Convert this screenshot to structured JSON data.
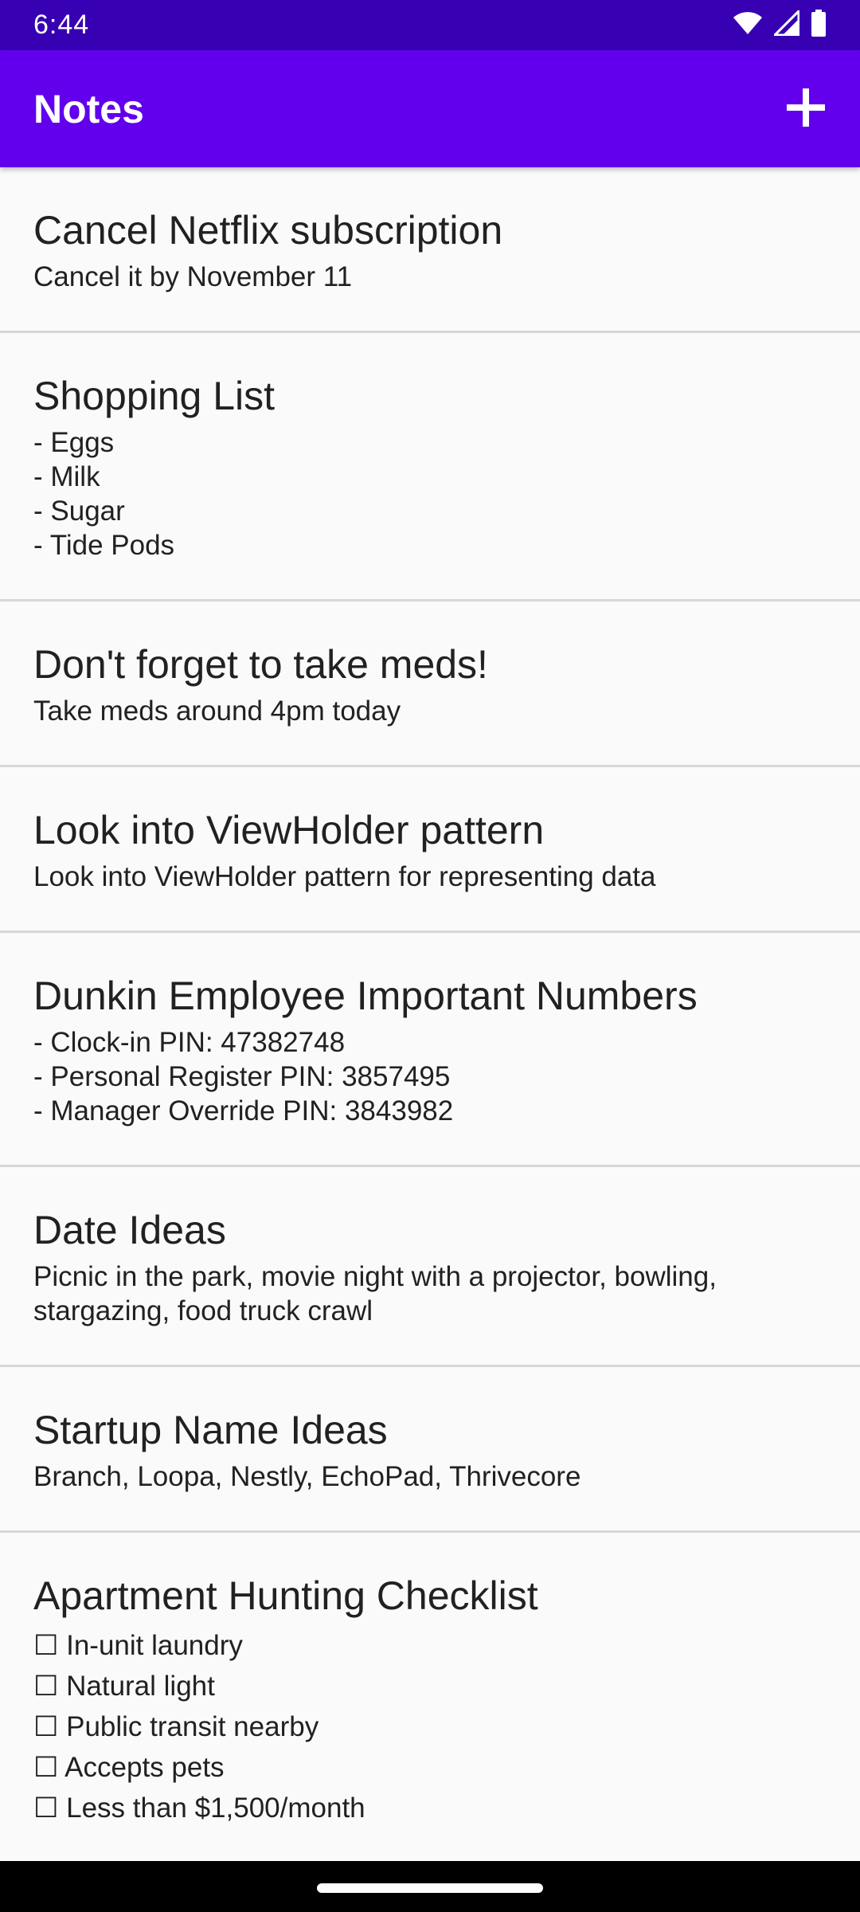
{
  "status_bar": {
    "time": "6:44",
    "icons": [
      "wifi-icon",
      "cellular-signal-icon",
      "battery-icon"
    ]
  },
  "app_bar": {
    "title": "Notes",
    "add_icon": "plus-icon",
    "color": "#6200ee"
  },
  "notes": [
    {
      "title": "Cancel Netflix subscription",
      "body": "Cancel it by November 11"
    },
    {
      "title": "Shopping List",
      "body": "- Eggs\n- Milk\n- Sugar\n- Tide Pods"
    },
    {
      "title": "Don't forget to take meds!",
      "body": "Take meds around 4pm today"
    },
    {
      "title": "Look into ViewHolder pattern",
      "body": "Look into ViewHolder pattern for representing data"
    },
    {
      "title": "Dunkin Employee Important Numbers",
      "body": "- Clock-in PIN: 47382748\n- Personal Register PIN: 3857495\n- Manager Override PIN: 3843982"
    },
    {
      "title": "Date Ideas",
      "body": "Picnic in the park, movie night with a projector, bowling, stargazing, food truck crawl"
    },
    {
      "title": "Startup Name Ideas",
      "body": "Branch, Loopa, Nestly, EchoPad, Thrivecore"
    },
    {
      "title": "Apartment Hunting Checklist",
      "body": "☐ In-unit laundry\n☐ Natural light\n☐ Public transit nearby\n☐ Accepts pets\n☐ Less than $1,500/month"
    }
  ],
  "colors": {
    "status_bar": "#3700b3",
    "app_bar": "#6200ee",
    "background": "#fafafa",
    "divider": "#d7d7d7",
    "text": "#212121"
  }
}
